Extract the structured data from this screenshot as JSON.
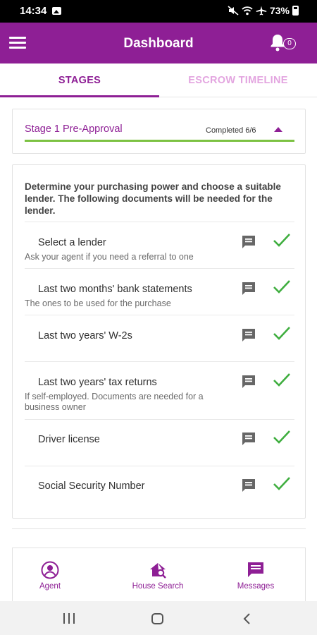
{
  "status_bar": {
    "time": "14:34",
    "battery": "73%"
  },
  "app_bar": {
    "title": "Dashboard",
    "notification_count": "0"
  },
  "tabs": [
    {
      "label": "STAGES",
      "active": true
    },
    {
      "label": "ESCROW TIMELINE",
      "active": false
    }
  ],
  "stage": {
    "title": "Stage 1 Pre-Approval",
    "completed": "Completed 6/6",
    "progress": 1.0
  },
  "details": {
    "intro": "Determine your purchasing power and choose a suitable lender. The following documents will be needed for the lender.",
    "tasks": [
      {
        "title": "Select a lender",
        "subtitle": "Ask your agent if you need a referral to one",
        "done": true
      },
      {
        "title": "Last two months' bank statements",
        "subtitle": "The ones to be used for the purchase",
        "done": true
      },
      {
        "title": "Last two years' W-2s",
        "subtitle": "",
        "done": true
      },
      {
        "title": "Last two years' tax returns",
        "subtitle": "If self-employed. Documents are needed for a business owner",
        "done": true
      },
      {
        "title": "Driver license",
        "subtitle": "",
        "done": true
      },
      {
        "title": "Social Security Number",
        "subtitle": "",
        "done": true
      }
    ]
  },
  "bottom_nav": [
    {
      "label": "Agent",
      "icon": "person-circle-icon"
    },
    {
      "label": "House Search",
      "icon": "house-search-icon"
    },
    {
      "label": "Messages",
      "icon": "message-icon"
    }
  ],
  "colors": {
    "primary": "#8e1f95",
    "accent_light": "#e3a5e0",
    "success": "#7cc242",
    "check": "#3fae3f"
  }
}
